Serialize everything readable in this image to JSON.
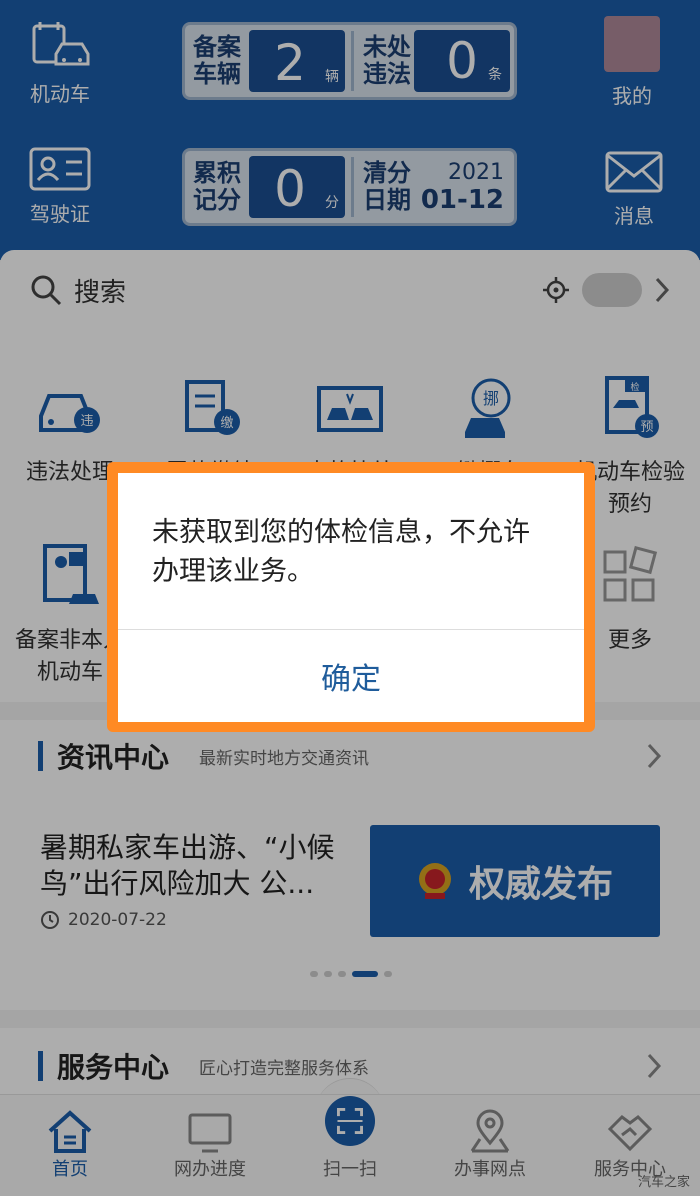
{
  "header": {
    "vehicle_label": "机动车",
    "license_label": "驾驶证",
    "mine_label": "我的",
    "message_label": "消息",
    "plate1": {
      "label_a": "备案车辆",
      "value_a": "2",
      "unit_a": "辆",
      "label_b": "未处违法",
      "value_b": "0",
      "unit_b": "条"
    },
    "plate2": {
      "label_a": "累积记分",
      "value_a": "0",
      "unit_a": "分",
      "label_b": "清分日期",
      "year": "2021",
      "date": "01-12"
    }
  },
  "search": {
    "placeholder": "搜索"
  },
  "grid": {
    "items": [
      {
        "label": "违法处理",
        "icon": "car-violation-icon"
      },
      {
        "label": "罚款缴纳",
        "icon": "fine-payment-icon"
      },
      {
        "label": "事故快处",
        "icon": "accident-icon"
      },
      {
        "label": "键挪车",
        "icon": "move-car-icon"
      },
      {
        "label": "机动车检验预约",
        "icon": "inspection-booking-icon"
      },
      {
        "label": "备案非本人机动车",
        "icon": "register-vehicle-icon"
      },
      {
        "label": "更多",
        "icon": "more-grid-icon"
      }
    ]
  },
  "news_section": {
    "title": "资讯中心",
    "subtitle": "最新实时地方交通资讯"
  },
  "news": {
    "title": "暑期私家车出游、“小候鸟”出行风险加大 公...",
    "date": "2020-07-22",
    "banner_text": "权威发布"
  },
  "service_section": {
    "title": "服务中心",
    "subtitle": "匠心打造完整服务体系"
  },
  "tabs": [
    {
      "label": "首页",
      "icon": "home-icon"
    },
    {
      "label": "网办进度",
      "icon": "monitor-icon"
    },
    {
      "label": "扫一扫",
      "icon": "scan-icon"
    },
    {
      "label": "办事网点",
      "icon": "location-icon"
    },
    {
      "label": "服务中心",
      "icon": "service-icon"
    }
  ],
  "dialog": {
    "message": "未获取到您的体检信息，不允许办理该业务。",
    "confirm": "确定"
  },
  "watermark": "汽车之家",
  "colors": {
    "primary": "#1b5eaa",
    "highlight": "#ff8a24"
  }
}
